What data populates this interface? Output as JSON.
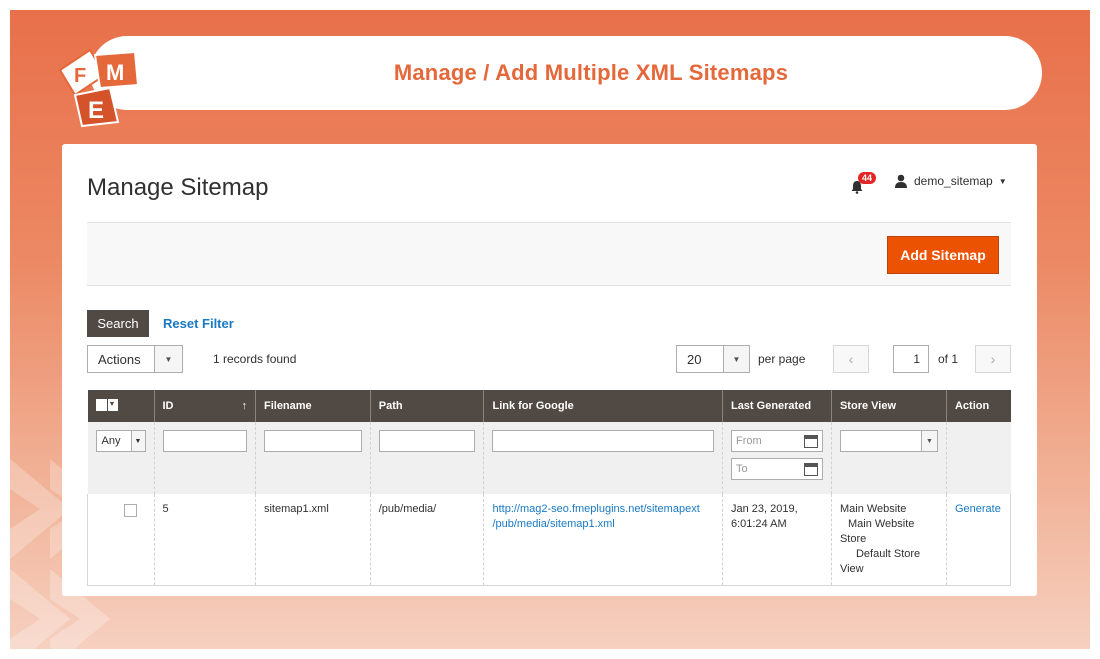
{
  "banner": {
    "title": "Manage / Add Multiple XML Sitemaps"
  },
  "logo": {
    "letters": [
      "F",
      "M",
      "E"
    ]
  },
  "header": {
    "page_title": "Manage Sitemap",
    "notifications_count": "44",
    "username": "demo_sitemap"
  },
  "toolbar": {
    "add_label": "Add Sitemap"
  },
  "filters": {
    "search_label": "Search",
    "reset_label": "Reset Filter",
    "actions_label": "Actions",
    "records_found": "1 records found",
    "per_page_value": "20",
    "per_page_label": "per page",
    "current_page": "1",
    "total_pages": "of 1",
    "any_label": "Any",
    "from_placeholder": "From",
    "to_placeholder": "To"
  },
  "table": {
    "columns": [
      "ID",
      "Filename",
      "Path",
      "Link for Google",
      "Last Generated",
      "Store View",
      "Action"
    ],
    "sort_indicator": "↑",
    "rows": [
      {
        "id": "5",
        "filename": "sitemap1.xml",
        "path": "/pub/media/",
        "link_line1": "http://mag2-seo.fmeplugins.net/sitemapext",
        "link_line2": "/pub/media/sitemap1.xml",
        "generated_line1": "Jan 23, 2019,",
        "generated_line2": "6:01:24 AM",
        "store_line1": "Main Website",
        "store_line2": "Main Website",
        "store_line3": "Store",
        "store_line4": "Default Store",
        "store_line5": "View",
        "action": "Generate"
      }
    ]
  },
  "colors": {
    "accent": "#eb5202",
    "header_bg": "#514943",
    "link": "#1979c3",
    "banner_text": "#e5683a"
  }
}
